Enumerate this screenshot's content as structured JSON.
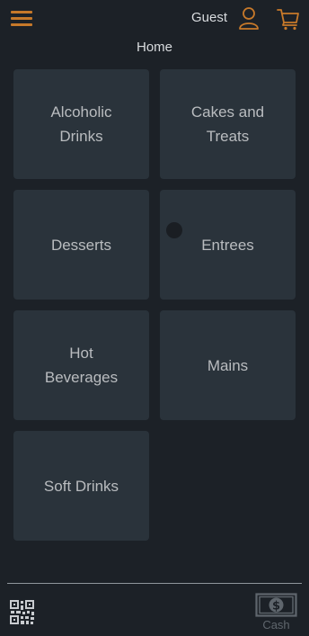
{
  "header": {
    "menu_icon": "hamburger-menu-icon",
    "user_label": "Guest",
    "user_icon": "user-icon",
    "cart_icon": "cart-icon"
  },
  "page": {
    "title": "Home"
  },
  "categories": [
    {
      "label": "Alcoholic Drinks"
    },
    {
      "label": "Cakes and Treats"
    },
    {
      "label": "Desserts"
    },
    {
      "label": "Entrees"
    },
    {
      "label": "Hot Beverages"
    },
    {
      "label": "Mains"
    },
    {
      "label": "Soft Drinks"
    }
  ],
  "footer": {
    "qr_icon": "qr-code-icon",
    "cash_icon": "dollar-banknote-icon",
    "cash_label": "Cash"
  },
  "colors": {
    "background": "#1c2127",
    "tile": "#2a333b",
    "accent": "#c7792a",
    "text": "#d8dbde",
    "tile_text": "#b9bcbf",
    "muted": "#5f666d"
  }
}
